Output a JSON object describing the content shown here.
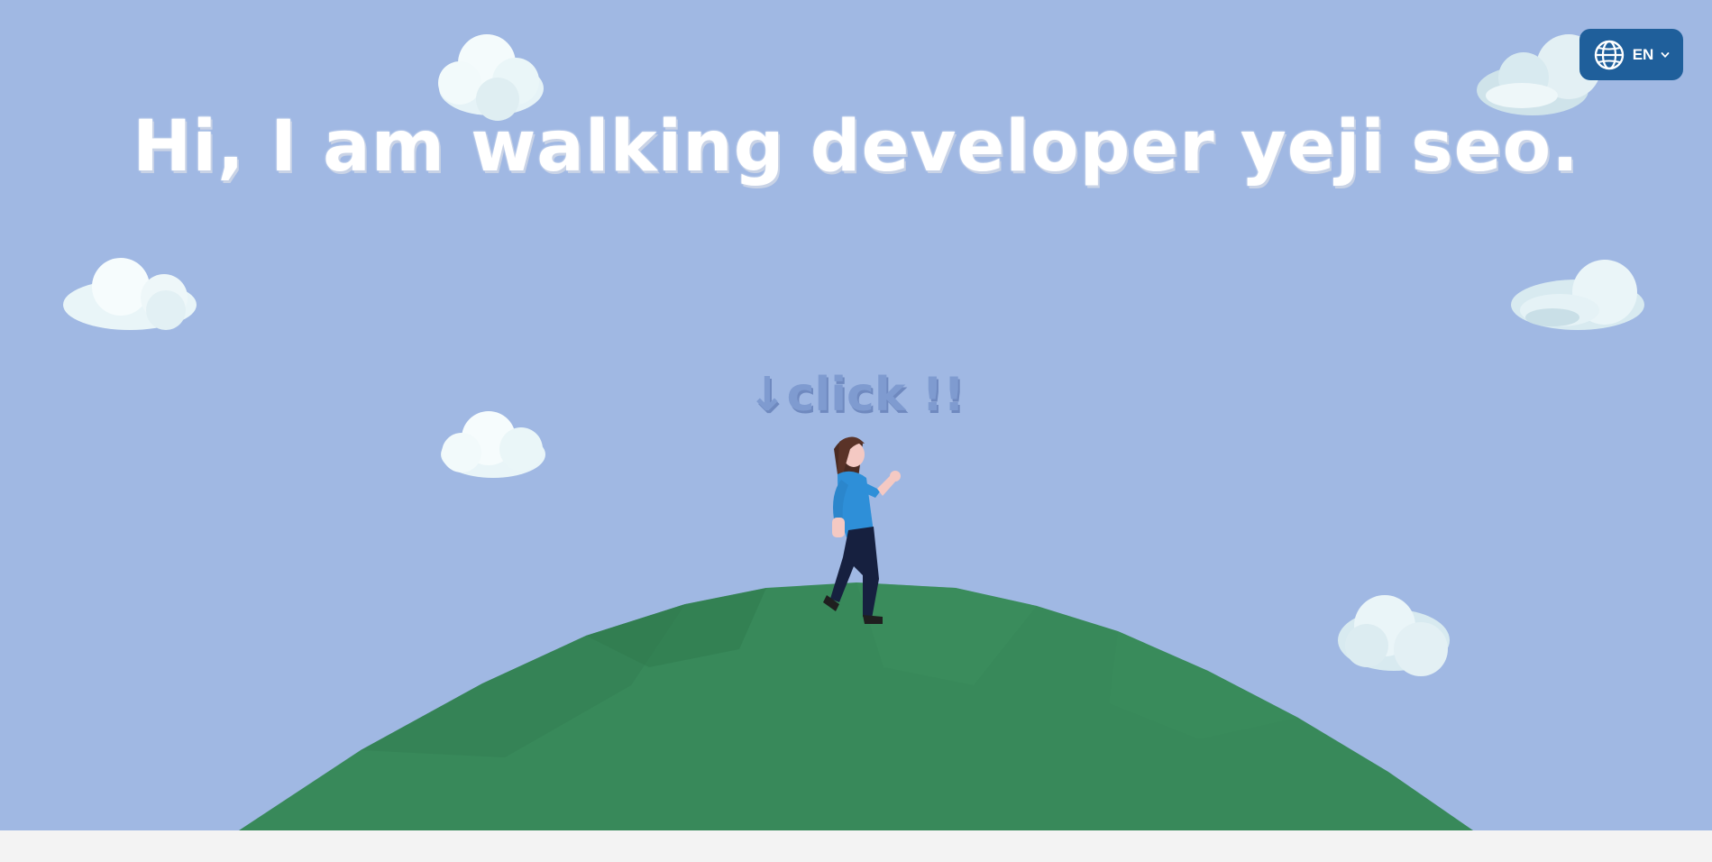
{
  "hero": {
    "title": "Hi, I am walking developer yeji seo.",
    "click_hint": "↓click !!"
  },
  "language_selector": {
    "current": "EN",
    "icon": "globe-icon",
    "chevron_icon": "chevron-down-icon"
  },
  "colors": {
    "sky": "#a0b8e3",
    "hill": "#38895a",
    "lang_button": "#1f5f9b",
    "title_text": "#ffffff",
    "hint_text": "#7f9bd0"
  }
}
